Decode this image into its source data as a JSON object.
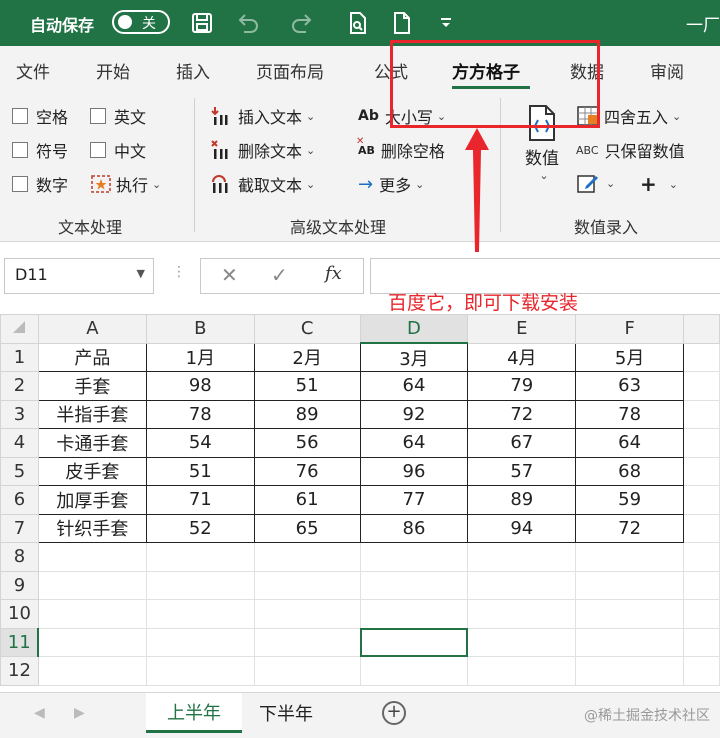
{
  "titlebar": {
    "autosave_label": "自动保存",
    "autosave_state": "关",
    "app_title_partial": "一厂"
  },
  "tabs": [
    {
      "label": "文件",
      "active": false
    },
    {
      "label": "开始",
      "active": false
    },
    {
      "label": "插入",
      "active": false
    },
    {
      "label": "页面布局",
      "active": false
    },
    {
      "label": "公式",
      "active": false
    },
    {
      "label": "方方格子",
      "active": true
    },
    {
      "label": "数据",
      "active": false
    },
    {
      "label": "审阅",
      "active": false
    }
  ],
  "ribbon": {
    "text_group": {
      "label": "文本处理",
      "checkboxes": [
        "空格",
        "英文",
        "符号",
        "中文",
        "数字"
      ],
      "execute": "执行"
    },
    "advanced_group": {
      "label": "高级文本处理",
      "insert_text": "插入文本",
      "delete_text": "删除文本",
      "extract_text": "截取文本",
      "case": "大小写",
      "case_icon": "Ab",
      "remove_spaces": "删除空格",
      "remove_spaces_icon": "AB",
      "more": "更多"
    },
    "number_group": {
      "label": "数值录入",
      "number_btn": "数值",
      "round": "四舍五入",
      "keep_values": "只保留数值",
      "keep_values_icon": "ABC",
      "plus": "+"
    }
  },
  "formula_bar": {
    "name_box": "D11",
    "fx": "fx",
    "value": ""
  },
  "annotation": "百度它，即可下载安装",
  "sheet": {
    "columns": [
      "A",
      "B",
      "C",
      "D",
      "E",
      "F"
    ],
    "selected_column": "D",
    "selected_row": "11",
    "rows": [
      [
        "产品",
        "1月",
        "2月",
        "3月",
        "4月",
        "5月"
      ],
      [
        "手套",
        "98",
        "51",
        "64",
        "79",
        "63"
      ],
      [
        "半指手套",
        "78",
        "89",
        "92",
        "72",
        "78"
      ],
      [
        "卡通手套",
        "54",
        "56",
        "64",
        "67",
        "64"
      ],
      [
        "皮手套",
        "51",
        "76",
        "96",
        "57",
        "68"
      ],
      [
        "加厚手套",
        "71",
        "61",
        "77",
        "89",
        "59"
      ],
      [
        "针织手套",
        "52",
        "65",
        "86",
        "94",
        "72"
      ]
    ],
    "row_numbers": [
      "1",
      "2",
      "3",
      "4",
      "5",
      "6",
      "7",
      "8",
      "9",
      "10",
      "11",
      "12"
    ]
  },
  "sheet_tabs": {
    "active": "上半年",
    "other": "下半年",
    "add": "+"
  },
  "watermark": "@稀土掘金技术社区",
  "colors": {
    "excel_green": "#217346",
    "annotation_red": "#e8262b"
  }
}
